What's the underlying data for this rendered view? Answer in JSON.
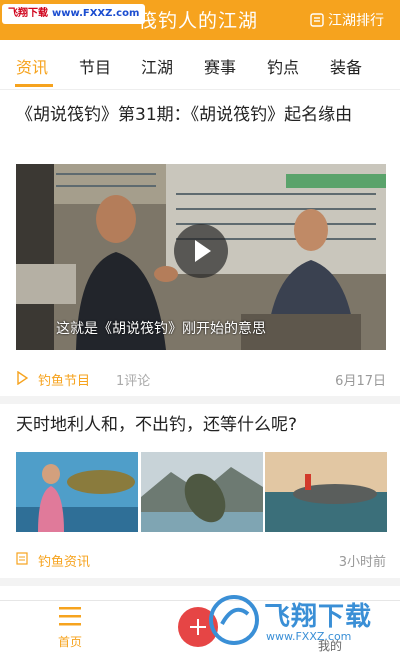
{
  "header": {
    "watermark_site": "飞翔下载",
    "watermark_url": "www.FXXZ.com",
    "title": "筏钓人的江湖",
    "rank_label": "江湖排行"
  },
  "tabs": [
    {
      "label": "资讯",
      "active": true
    },
    {
      "label": "节目",
      "active": false
    },
    {
      "label": "江湖",
      "active": false
    },
    {
      "label": "赛事",
      "active": false
    },
    {
      "label": "钓点",
      "active": false
    },
    {
      "label": "装备",
      "active": false
    }
  ],
  "articles": [
    {
      "title": "《胡说筏钓》第31期：《胡说筏钓》起名缘由",
      "video_subtitle": "这就是《胡说筏钓》刚开始的意思",
      "category": "钓鱼节目",
      "comments": "1评论",
      "time": "6月17日"
    },
    {
      "title": "天时地利人和，不出钓，还等什么呢?",
      "category": "钓鱼资讯",
      "time": "3小时前"
    }
  ],
  "bottom_nav": {
    "home_label": "首页",
    "me_label": "我的"
  },
  "watermark_bottom": {
    "big": "飞翔下载",
    "small": "www.FXXZ.com"
  },
  "colors": {
    "accent": "#f6a31e",
    "add_button": "#e64545"
  }
}
